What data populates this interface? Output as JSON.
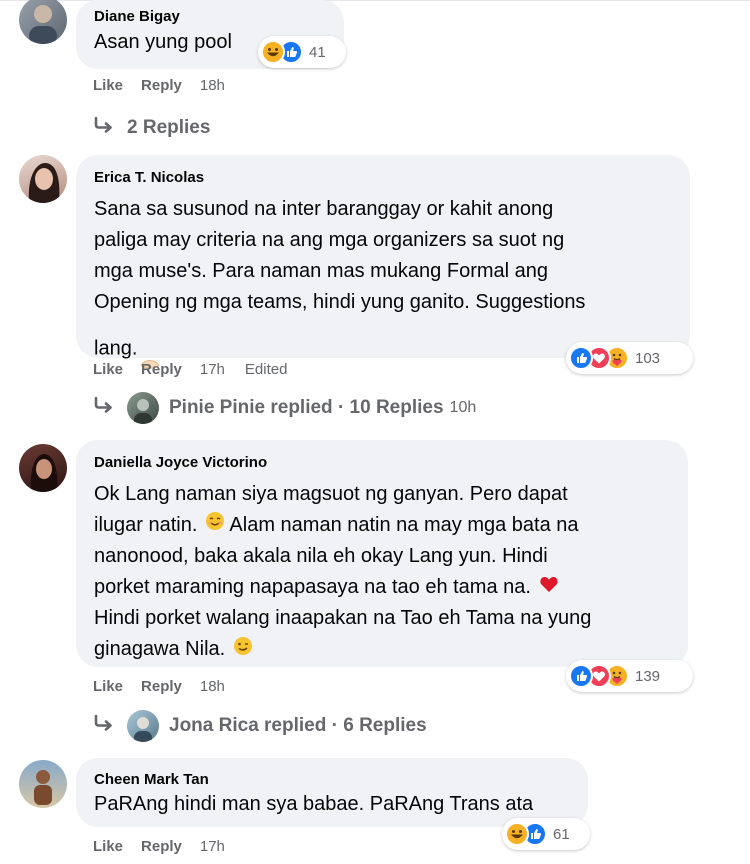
{
  "comments": [
    {
      "author": "Diane Bigay",
      "text": "Asan yung pool",
      "reaction_count": "41",
      "reactions": [
        "haha",
        "like"
      ],
      "like_label": "Like",
      "reply_label": "Reply",
      "time": "18h",
      "edited": "",
      "replies": {
        "text": "2 Replies",
        "replier": "",
        "time": ""
      }
    },
    {
      "author": "Erica T. Nicolas",
      "text": "Sana sa susunod na inter baranggay or kahit anong\npaliga may criteria na ang mga organizers sa suot ng\nmga muse's. Para naman mas mukang Formal ang\nOpening ng mga teams, hindi yung ganito. Suggestions\nlang.",
      "reaction_count": "103",
      "reactions": [
        "like",
        "love",
        "care"
      ],
      "like_label": "Like",
      "reply_label": "Reply",
      "time": "17h",
      "edited": "Edited",
      "replies": {
        "text": "Pinie Pinie replied · 10 Replies",
        "replier": "Pinie Pinie",
        "time": "10h"
      }
    },
    {
      "author": "Daniella Joyce Victorino",
      "text_lines": [
        "Ok Lang naman siya magsuot ng ganyan. Pero dapat",
        "ilugar natin.",
        "Alam naman natin na may mga bata na",
        "nanonood, baka akala nila eh okay Lang yun. Hindi",
        "porket maraming napapasaya na tao eh tama na.",
        "Hindi porket walang inaapakan na Tao eh Tama na yung",
        "ginagawa Nila."
      ],
      "reaction_count": "139",
      "reactions": [
        "like",
        "love",
        "care"
      ],
      "like_label": "Like",
      "reply_label": "Reply",
      "time": "18h",
      "edited": "",
      "replies": {
        "text": "Jona Rica replied · 6 Replies",
        "replier": "Jona Rica",
        "time": ""
      }
    },
    {
      "author": "Cheen Mark Tan",
      "text": "PaRAng hindi man sya babae. PaRAng Trans ata",
      "reaction_count": "61",
      "reactions": [
        "haha",
        "like"
      ],
      "like_label": "Like",
      "reply_label": "Reply",
      "time": "17h",
      "edited": ""
    }
  ],
  "colors": {
    "bubble": "#f0f2f5",
    "secondary_text": "#65676b",
    "like_blue": "#1877f2",
    "love_red": "#f33e58",
    "haha_yellow": "#f7b125"
  },
  "icons": {
    "reply_arrow": "reply-arrow-icon",
    "like": "like-reaction-icon",
    "love": "love-reaction-icon",
    "haha": "haha-reaction-icon",
    "care": "care-reaction-icon"
  }
}
